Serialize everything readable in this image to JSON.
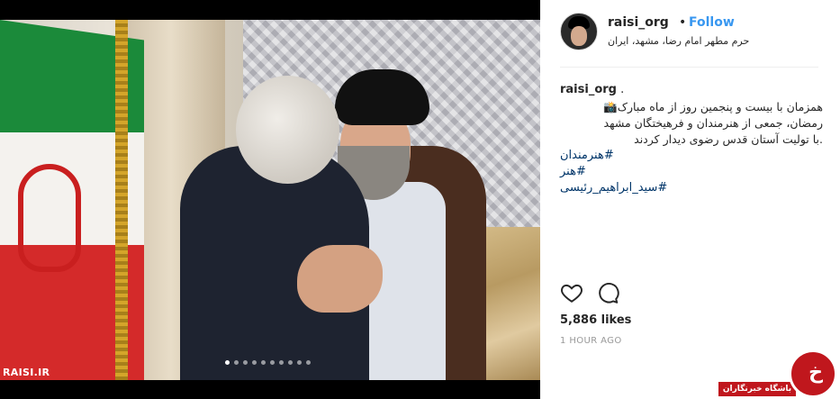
{
  "post": {
    "photo_watermark": "RAISI.IR",
    "carousel": {
      "count": 10,
      "active_index": 0
    }
  },
  "header": {
    "username": "raisi_org",
    "separator": "•",
    "follow_label": "Follow",
    "location": "حرم مطهر امام رضا، مشهد، ایران"
  },
  "caption": {
    "username": "raisi_org",
    "suffix": " .",
    "text": "همزمان با بیست و پنجمین روز از ماه مبارک📸\nرمضان، جمعی از هنرمندان و فرهیختگان مشهد\n.با تولیت آستان قدس رضوی دیدار کردند",
    "hashtags": [
      "#هنرمندان",
      "#هنر",
      "#سید_ابراهیم_رئیسی"
    ]
  },
  "actions": {
    "like_icon": "heart-icon",
    "comment_icon": "comment-icon"
  },
  "likes_text": "5,886 likes",
  "timestamp": "1 HOUR AGO",
  "brand": {
    "name": "باشگاه خبرنگاران",
    "glyph": "خ",
    "color": "#c0171d"
  },
  "colors": {
    "link": "#3897f0",
    "hashtag": "#003569",
    "text": "#262626",
    "muted": "#999999"
  }
}
